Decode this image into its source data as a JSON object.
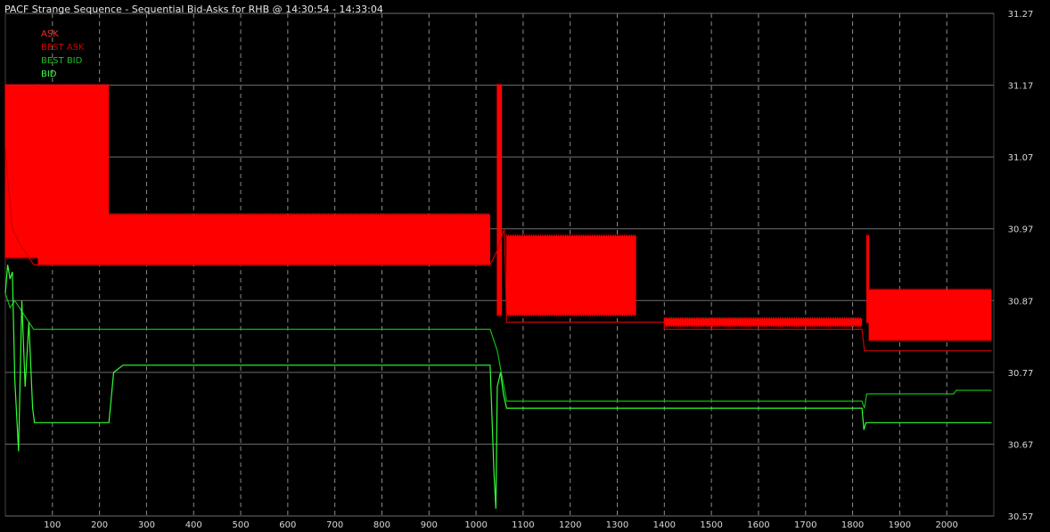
{
  "chart_data": {
    "type": "line",
    "title": "PACF Strange Sequence - Sequential Bid-Asks for RHB @ 14:30:54 - 14:33:04",
    "background_color": "#000000",
    "grid": true,
    "grid_color": "#7a7a7a",
    "xlim": [
      0,
      2100
    ],
    "ylim": [
      30.57,
      31.27
    ],
    "x_ticks": [
      100,
      200,
      300,
      400,
      500,
      600,
      700,
      800,
      900,
      1000,
      1100,
      1200,
      1300,
      1400,
      1500,
      1600,
      1700,
      1800,
      1900,
      2000
    ],
    "y_ticks": [
      30.57,
      30.67,
      30.77,
      30.87,
      30.97,
      31.07,
      31.17,
      31.27
    ],
    "legend_position": "top-left",
    "series": [
      {
        "name": "ASK",
        "color": "#ff0000",
        "style": "dense-oscillation",
        "blocks": [
          {
            "x": [
              -5,
              70
            ],
            "low": 30.93,
            "high": 31.17
          },
          {
            "x": [
              70,
              220
            ],
            "low": 30.92,
            "high": 31.17
          },
          {
            "x": [
              220,
              1030
            ],
            "low": 30.92,
            "high": 30.99
          },
          {
            "x": [
              1045,
              1055
            ],
            "low": 30.85,
            "high": 31.17
          },
          {
            "x": [
              1065,
              1340
            ],
            "low": 30.85,
            "high": 30.96
          },
          {
            "x": [
              1400,
              1820
            ],
            "low": 30.835,
            "high": 30.845
          },
          {
            "x": [
              1830,
              1835
            ],
            "low": 30.84,
            "high": 30.96
          },
          {
            "x": [
              1835,
              2095
            ],
            "low": 30.815,
            "high": 30.885
          }
        ]
      },
      {
        "name": "BEST ASK",
        "color": "#cc0000",
        "points": [
          [
            -5,
            31.08
          ],
          [
            5,
            31.04
          ],
          [
            15,
            30.97
          ],
          [
            30,
            30.95
          ],
          [
            60,
            30.92
          ],
          [
            300,
            30.92
          ],
          [
            1030,
            30.92
          ],
          [
            1045,
            30.94
          ],
          [
            1060,
            30.97
          ],
          [
            1065,
            30.84
          ],
          [
            1400,
            30.84
          ],
          [
            1400,
            30.83
          ],
          [
            1820,
            30.83
          ],
          [
            1825,
            30.8
          ],
          [
            2095,
            30.8
          ]
        ]
      },
      {
        "name": "BEST BID",
        "color": "#11bb11",
        "points": [
          [
            -5,
            30.88
          ],
          [
            10,
            30.86
          ],
          [
            20,
            30.87
          ],
          [
            40,
            30.85
          ],
          [
            60,
            30.83
          ],
          [
            1030,
            30.83
          ],
          [
            1045,
            30.8
          ],
          [
            1065,
            30.73
          ],
          [
            1820,
            30.73
          ],
          [
            1825,
            30.72
          ],
          [
            1830,
            30.74
          ],
          [
            2015,
            30.74
          ],
          [
            2020,
            30.745
          ],
          [
            2095,
            30.745
          ]
        ]
      },
      {
        "name": "BID",
        "color": "#33ff33",
        "points": [
          [
            -5,
            30.88
          ],
          [
            5,
            30.92
          ],
          [
            10,
            30.9
          ],
          [
            15,
            30.91
          ],
          [
            20,
            30.76
          ],
          [
            28,
            30.66
          ],
          [
            35,
            30.87
          ],
          [
            42,
            30.75
          ],
          [
            50,
            30.84
          ],
          [
            58,
            30.72
          ],
          [
            62,
            30.7
          ],
          [
            120,
            30.7
          ],
          [
            200,
            30.7
          ],
          [
            220,
            30.7
          ],
          [
            230,
            30.77
          ],
          [
            250,
            30.78
          ],
          [
            1030,
            30.78
          ],
          [
            1038,
            30.63
          ],
          [
            1042,
            30.58
          ],
          [
            1045,
            30.75
          ],
          [
            1052,
            30.77
          ],
          [
            1058,
            30.74
          ],
          [
            1065,
            30.72
          ],
          [
            1820,
            30.72
          ],
          [
            1824,
            30.69
          ],
          [
            1828,
            30.7
          ],
          [
            2095,
            30.7
          ]
        ]
      }
    ]
  }
}
